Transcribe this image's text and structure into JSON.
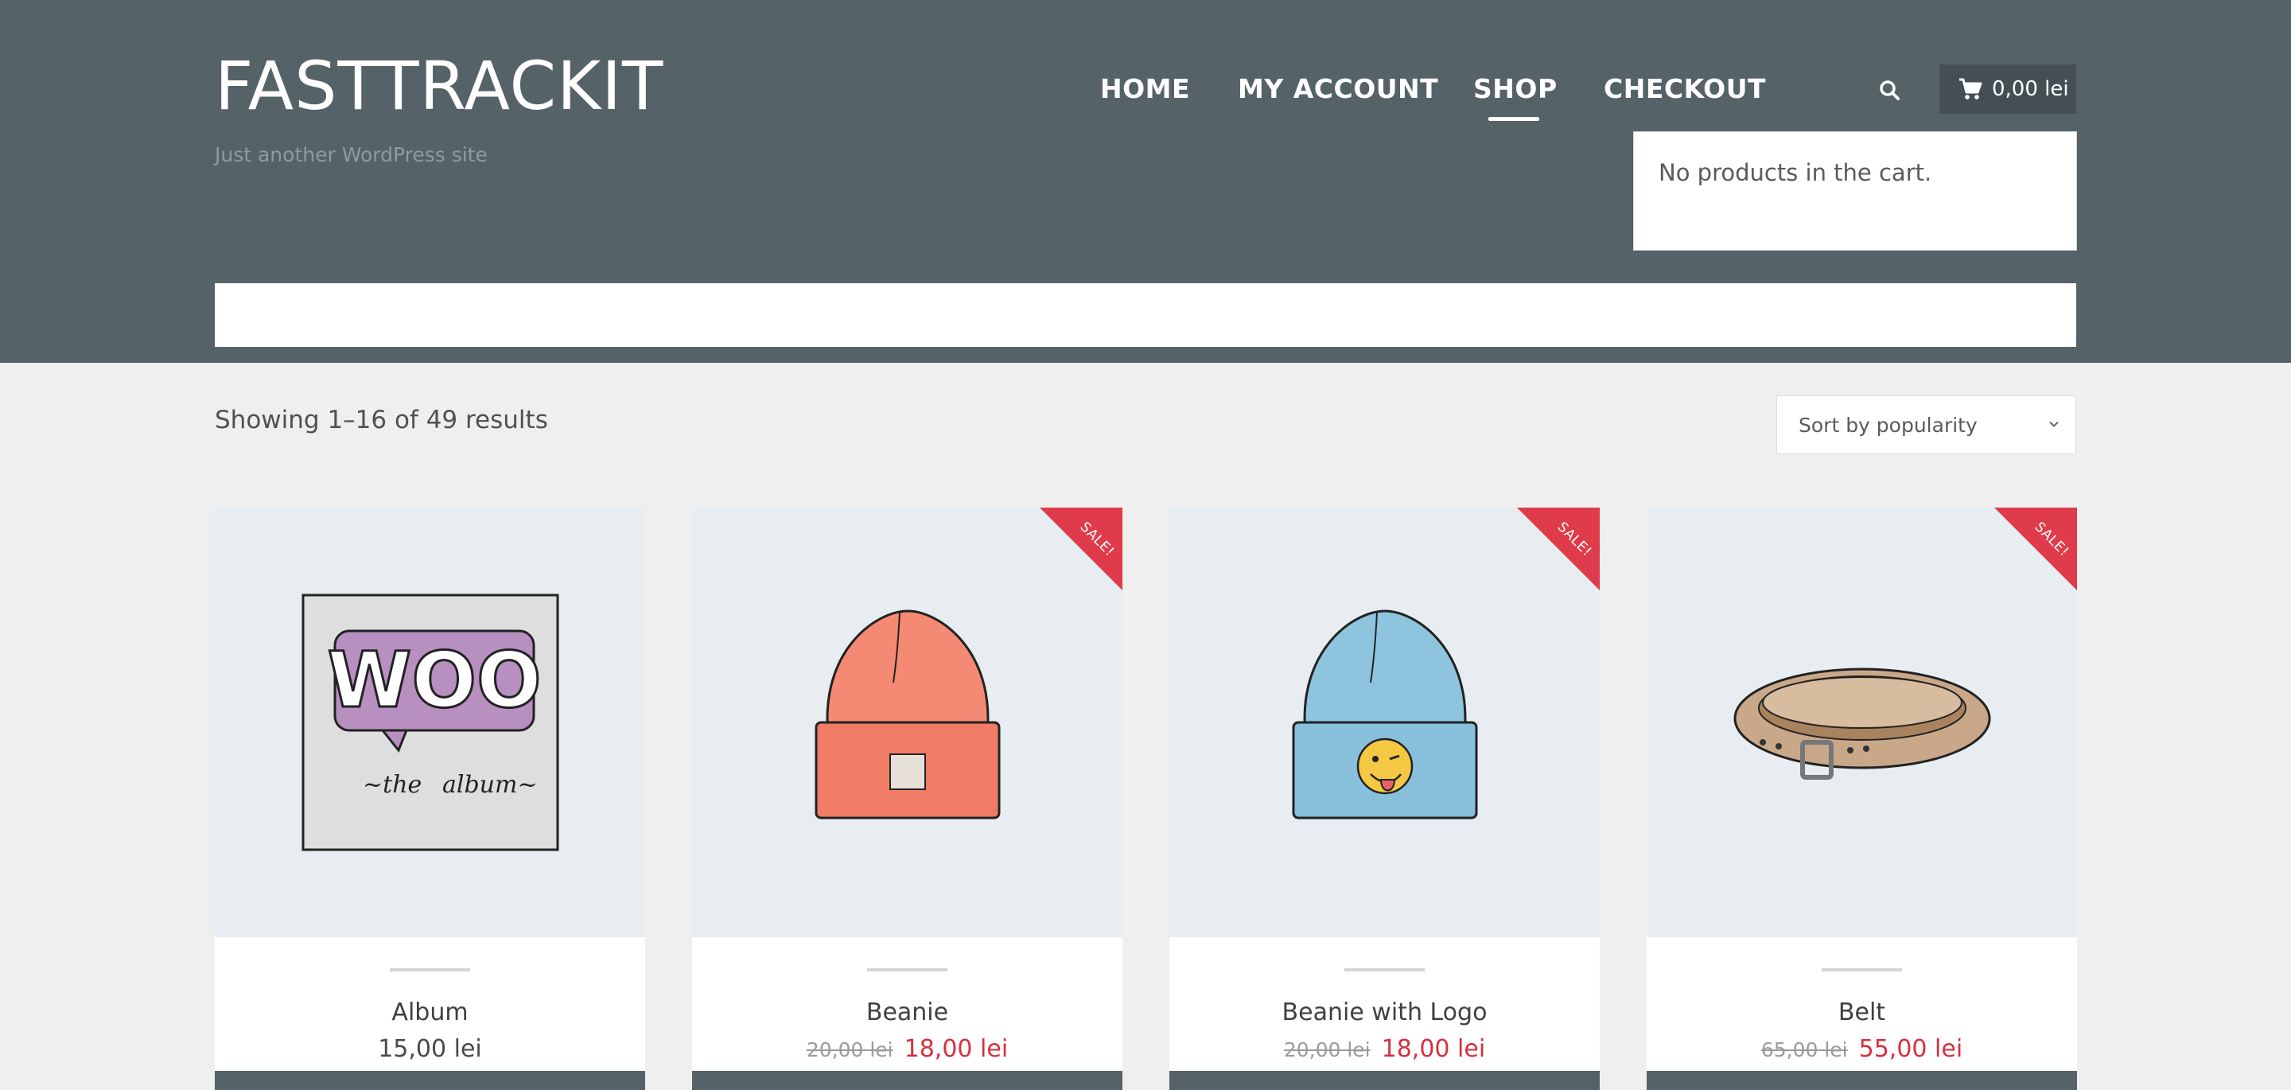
{
  "site": {
    "title": "FASTTRACKIT",
    "tagline": "Just another WordPress site"
  },
  "nav": {
    "items": [
      {
        "label": "HOME"
      },
      {
        "label": "MY ACCOUNT"
      },
      {
        "label": "SHOP",
        "active": true
      },
      {
        "label": "CHECKOUT"
      }
    ]
  },
  "header": {
    "search_icon": "search-icon",
    "cart_icon": "cart-icon",
    "cart_total": "0,00 lei",
    "cart_empty_message": "No products in the cart."
  },
  "shop": {
    "result_count": "Showing 1–16 of 49 results",
    "sort_selected": "Sort by popularity"
  },
  "products": [
    {
      "name": "Album",
      "price": "15,00 lei",
      "on_sale": false,
      "image_icon": "album-icon"
    },
    {
      "name": "Beanie",
      "old_price": "20,00 lei",
      "sale_price": "18,00 lei",
      "on_sale": true,
      "sale_label": "SALE!",
      "image_icon": "beanie-icon"
    },
    {
      "name": "Beanie with Logo",
      "old_price": "20,00 lei",
      "sale_price": "18,00 lei",
      "on_sale": true,
      "sale_label": "SALE!",
      "image_icon": "beanie-logo-icon"
    },
    {
      "name": "Belt",
      "old_price": "65,00 lei",
      "sale_price": "55,00 lei",
      "on_sale": true,
      "sale_label": "SALE!",
      "image_icon": "belt-icon"
    }
  ],
  "colors": {
    "header_bg": "#556268",
    "sale_red": "#e03b4a",
    "price_red": "#d7303f",
    "page_bg": "#efefef"
  }
}
